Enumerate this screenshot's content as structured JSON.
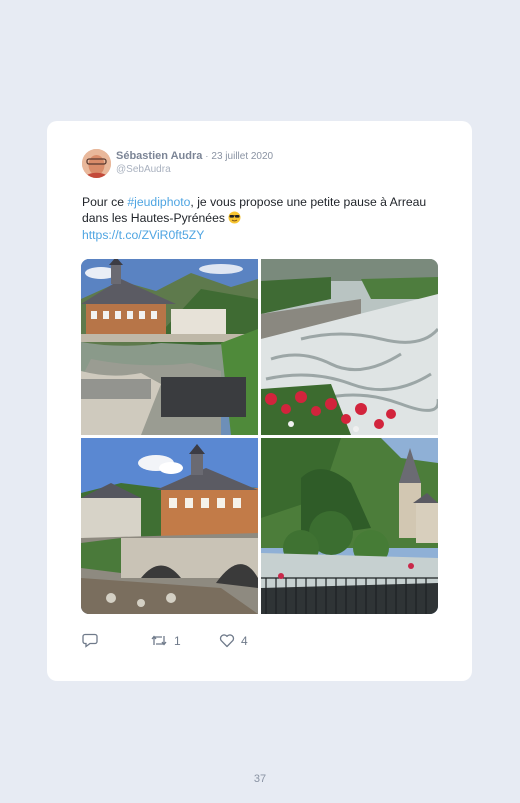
{
  "tweet": {
    "author_name": "Sébastien Audra",
    "separator": "·",
    "date": "23 juillet 2020",
    "handle": "@SebAudra",
    "text_before": "Pour ce ",
    "hashtag": "#jeudiphoto",
    "text_after": ", je vous propose une petite pause à Arreau dans les Hautes-Pyrénées ",
    "emoji": "😎",
    "link": "https://t.co/ZViR0ft5ZY",
    "photos": [
      "town-hall-with-mountains",
      "river-rapids-with-flowers",
      "stone-bridge-and-houses",
      "church-and-green-hills"
    ],
    "reply_count": "",
    "retweet_count": "1",
    "like_count": "4"
  },
  "icons": [
    "reply-icon",
    "retweet-icon",
    "heart-icon"
  ],
  "colors": {
    "background": "#e7ebf3",
    "card": "#ffffff",
    "link": "#4fa5e2",
    "muted": "#8a93a3"
  },
  "page_number": "37"
}
